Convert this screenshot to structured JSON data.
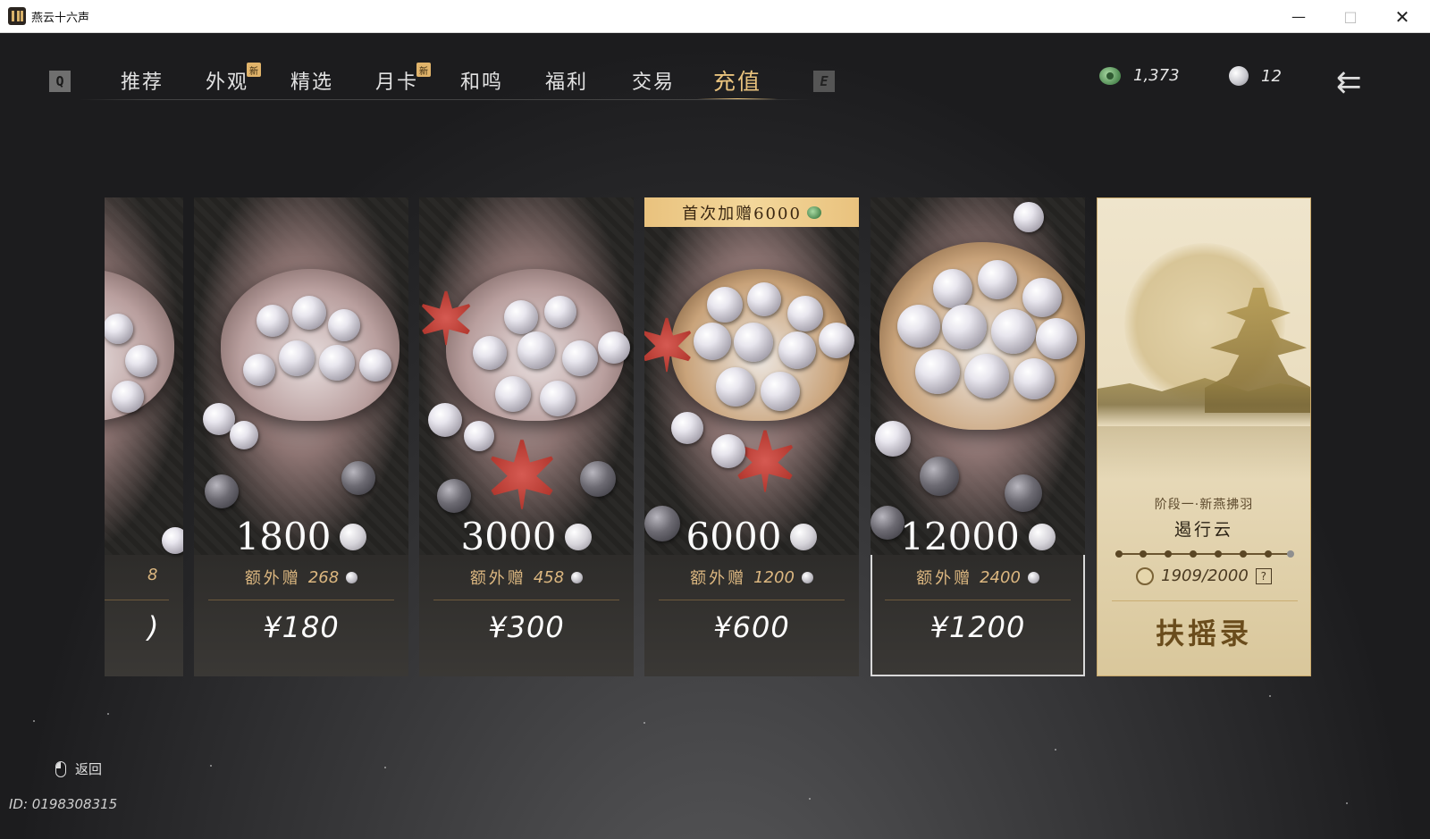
{
  "window": {
    "title": "燕云十六声",
    "controls": {
      "minimize": "—",
      "maximize": "□",
      "close": "✕"
    }
  },
  "nav": {
    "key_left": "Q",
    "key_right": "E",
    "tabs": [
      {
        "label": "推荐",
        "new": false,
        "active": false
      },
      {
        "label": "外观",
        "new": true,
        "active": false
      },
      {
        "label": "精选",
        "new": false,
        "active": false
      },
      {
        "label": "月卡",
        "new": true,
        "active": false
      },
      {
        "label": "和鸣",
        "new": false,
        "active": false
      },
      {
        "label": "福利",
        "new": false,
        "active": false
      },
      {
        "label": "交易",
        "new": false,
        "active": false
      },
      {
        "label": "充值",
        "new": false,
        "active": true
      }
    ],
    "new_badge": "新"
  },
  "currency": {
    "jade": "1,373",
    "pearl": "12"
  },
  "back_arrow": "⇇",
  "partial_card": {
    "bonus_visible": "8",
    "price_visible": ")"
  },
  "cards": [
    {
      "amount": "1800",
      "bonus_label": "额外赠",
      "bonus": "268",
      "price": "¥180",
      "selected": false,
      "first_bonus": ""
    },
    {
      "amount": "3000",
      "bonus_label": "额外赠",
      "bonus": "458",
      "price": "¥300",
      "selected": false,
      "first_bonus": ""
    },
    {
      "amount": "6000",
      "bonus_label": "额外赠",
      "bonus": "1200",
      "price": "¥600",
      "selected": false,
      "first_bonus": "首次加赠6000"
    },
    {
      "amount": "12000",
      "bonus_label": "额外赠",
      "bonus": "2400",
      "price": "¥1200",
      "selected": true,
      "first_bonus": ""
    }
  ],
  "promo": {
    "stage": "阶段一·新燕拂羽",
    "name": "遏行云",
    "progress": "1909/2000",
    "progress_fraction": 0.9545,
    "help": "?",
    "title": "扶摇录"
  },
  "footer": {
    "back_hint": "返回",
    "uid": "ID: 0198308315"
  },
  "colors": {
    "accent_gold": "#e8c27d",
    "bonus_gold": "#dcb780",
    "first_bonus_bg": "#f3d79a",
    "promo_bg": "#efe5cc"
  },
  "icons": [
    "jade-icon",
    "pearl-icon",
    "back-arrow-icon",
    "mouse-icon",
    "help-icon"
  ]
}
